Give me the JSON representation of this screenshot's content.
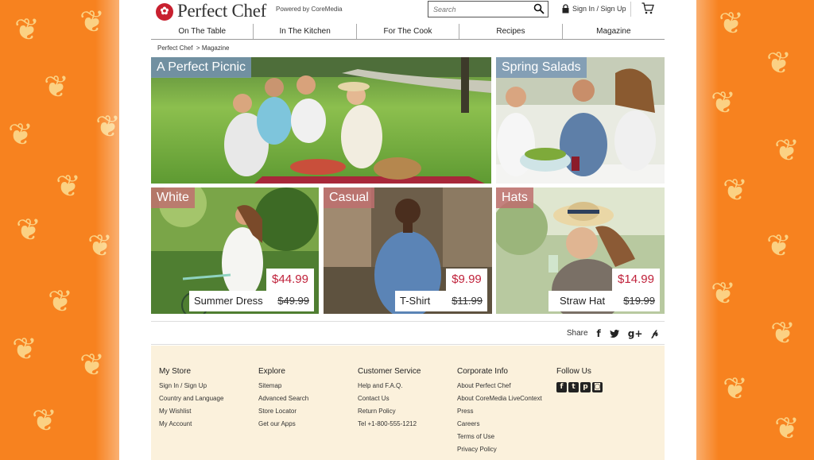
{
  "header": {
    "brand": "Perfect Chef",
    "powered_by": "Powered by CoreMedia",
    "search_placeholder": "Search",
    "signin_label": "Sign In / Sign Up"
  },
  "nav": {
    "items": [
      "On The Table",
      "In The Kitchen",
      "For The Cook",
      "Recipes",
      "Magazine"
    ]
  },
  "breadcrumb": {
    "home": "Perfect Chef",
    "current": "> Magazine"
  },
  "tiles": {
    "picnic": {
      "label": "A Perfect Picnic"
    },
    "salads": {
      "label": "Spring Salads"
    },
    "white": {
      "label": "White",
      "price": "$44.99",
      "name": "Summer Dress",
      "old_price": "$49.99"
    },
    "casual": {
      "label": "Casual",
      "price": "$9.99",
      "name": "T-Shirt",
      "old_price": "$11.99"
    },
    "hats": {
      "label": "Hats",
      "price": "$14.99",
      "name": "Straw Hat",
      "old_price": "$19.99"
    }
  },
  "share": {
    "label": "Share"
  },
  "footer": {
    "my_store": {
      "title": "My Store",
      "links": [
        "Sign In / Sign Up",
        "Country and Language",
        "My Wishlist",
        "My Account"
      ]
    },
    "explore": {
      "title": "Explore",
      "links": [
        "Sitemap",
        "Advanced Search",
        "Store Locator",
        "Get our Apps"
      ]
    },
    "customer_service": {
      "title": "Customer Service",
      "links": [
        "Help and F.A.Q.",
        "Contact Us",
        "Return Policy",
        "Tel +1-800-555-1212"
      ]
    },
    "corporate_info": {
      "title": "Corporate Info",
      "links": [
        "About Perfect Chef",
        "About CoreMedia LiveContext",
        "Press",
        "Careers",
        "Terms of Use",
        "Privacy Policy"
      ]
    },
    "follow_us": {
      "title": "Follow Us"
    }
  },
  "colors": {
    "background": "#f7821f",
    "leaf": "#fbd183",
    "price": "#c0223b",
    "footer_bg": "#fbf1dc",
    "label_blue": "#7896b4",
    "label_pink": "#be6e6e"
  }
}
